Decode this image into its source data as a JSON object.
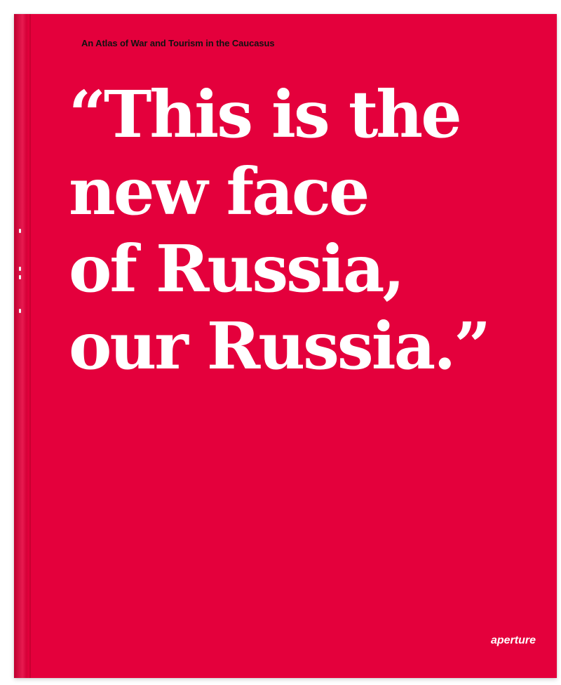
{
  "cover": {
    "background_color": "#e4003c",
    "subtitle": "An Atlas of War and Tourism in the Caucasus",
    "quote_lines": [
      "“This is the",
      "new face",
      "of Russia,",
      "our Russia.”"
    ],
    "publisher": "aperture"
  }
}
